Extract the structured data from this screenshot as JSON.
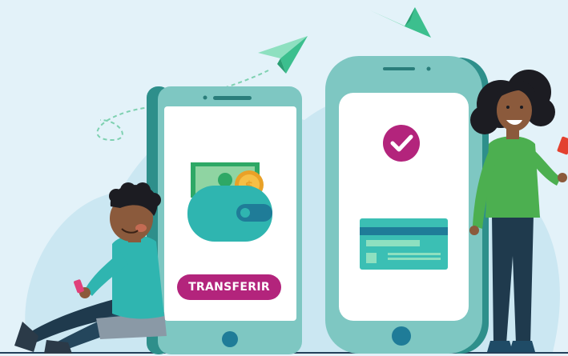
{
  "transfer_button": {
    "label": "TRANSFERIR"
  },
  "colors": {
    "background": "#e3f2f9",
    "phone_teal": "#7ec7c2",
    "accent_magenta": "#b3247c",
    "card_teal": "#3bbfb4",
    "wallet_teal": "#2fb5b0"
  },
  "icons": [
    "paper-plane-icon",
    "wallet-icon",
    "coin-icon",
    "check-icon",
    "credit-card-icon"
  ]
}
